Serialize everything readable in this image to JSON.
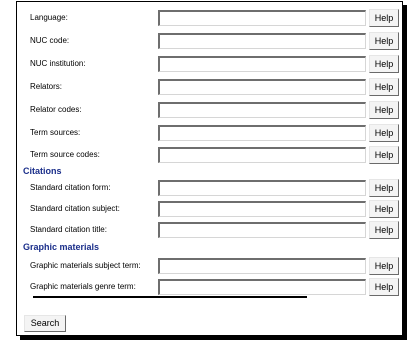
{
  "help_label": "Help",
  "fields_group_1": [
    {
      "label": "Language:"
    },
    {
      "label": "NUC code:"
    },
    {
      "label": "NUC institution:"
    },
    {
      "label": "Relators:"
    },
    {
      "label": "Relator codes:"
    },
    {
      "label": "Term sources:"
    },
    {
      "label": "Term source codes:"
    }
  ],
  "citations": {
    "heading": "Citations",
    "fields": [
      {
        "label": "Standard citation form:"
      },
      {
        "label": "Standard citation subject:"
      },
      {
        "label": "Standard citation title:"
      }
    ]
  },
  "graphic_materials": {
    "heading": "Graphic materials",
    "fields": [
      {
        "label": "Graphic materials subject term:"
      },
      {
        "label": "Graphic materials genre term:"
      }
    ]
  },
  "search_label": "Search",
  "colors": {
    "section_heading": "#1a2e8a",
    "panel_border": "#000000",
    "button_face": "#f4f4f4"
  }
}
